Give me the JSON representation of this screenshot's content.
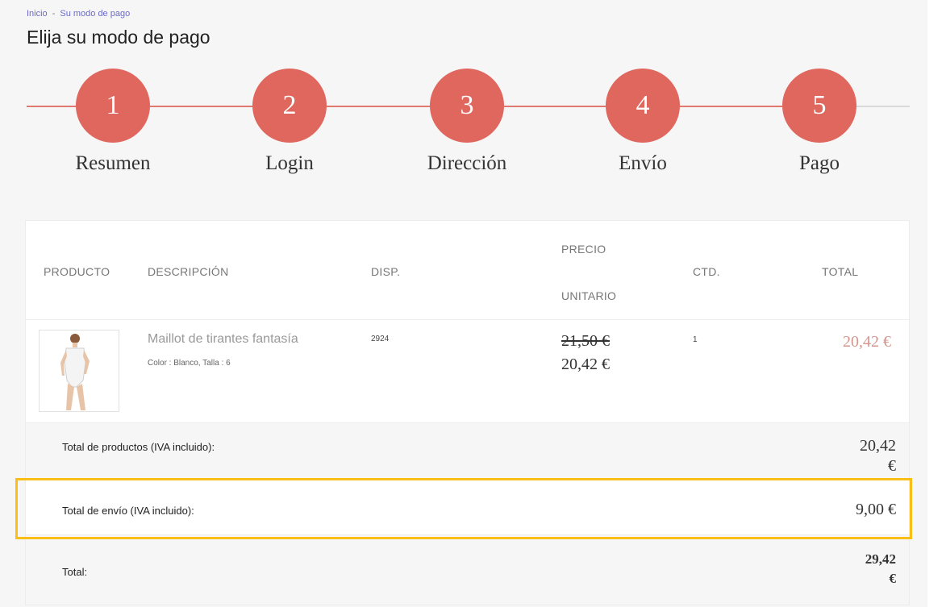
{
  "breadcrumb": {
    "home": "Inicio",
    "separator": "-",
    "current": "Su modo de pago"
  },
  "page_title": "Elija su modo de pago",
  "steps": [
    {
      "number": "1",
      "label": "Resumen"
    },
    {
      "number": "2",
      "label": "Login"
    },
    {
      "number": "3",
      "label": "Dirección"
    },
    {
      "number": "4",
      "label": "Envío"
    },
    {
      "number": "5",
      "label": "Pago"
    }
  ],
  "colors": {
    "step_accent": "#e0675e",
    "highlight": "#f9bf17"
  },
  "cart": {
    "headers": {
      "product": "PRODUCTO",
      "description": "DESCRIPCIÓN",
      "availability": "DISP.",
      "unit_price_line1": "PRECIO",
      "unit_price_line2": "UNITARIO",
      "quantity": "CTD.",
      "total": "TOTAL"
    },
    "item": {
      "name": "Maillot de tirantes fantasía",
      "attributes": "Color : Blanco, Talla : 6",
      "availability": "2924",
      "old_price": "21,50 €",
      "price": "20,42 €",
      "quantity": "1",
      "total": "20,42 €"
    },
    "summary": {
      "products_label": "Total de productos (IVA incluido):",
      "products_value_line1": "20,42",
      "products_value_line2": "€",
      "shipping_label": "Total de envío (IVA incluido):",
      "shipping_value": "9,00 €",
      "total_label": "Total:",
      "total_value_line1": "29,42",
      "total_value_line2": "€"
    }
  }
}
